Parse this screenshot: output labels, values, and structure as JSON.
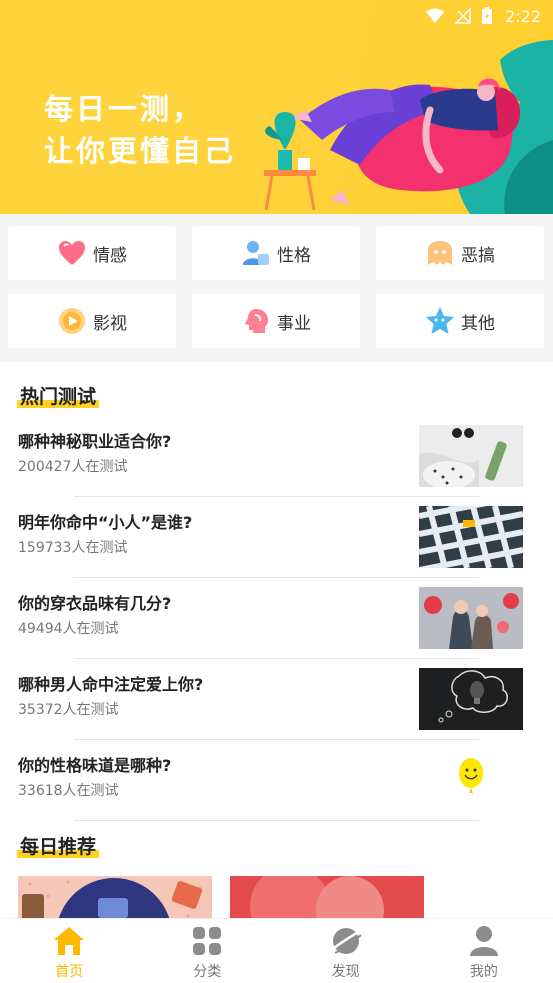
{
  "status_bar": {
    "time": "2:22"
  },
  "banner": {
    "line1": "每日一测，",
    "line2": "让你更懂自己"
  },
  "categories": [
    {
      "label": "情感",
      "icon": "heart-icon",
      "color": "#ff6b8a"
    },
    {
      "label": "性格",
      "icon": "person-icon",
      "color": "#5aa8f0"
    },
    {
      "label": "恶搞",
      "icon": "ghost-icon",
      "color": "#ffb65c"
    },
    {
      "label": "影视",
      "icon": "play-icon",
      "color": "#ffb53c"
    },
    {
      "label": "事业",
      "icon": "head-icon",
      "color": "#ff7a8c"
    },
    {
      "label": "其他",
      "icon": "star-icon",
      "color": "#4bb6f0"
    }
  ],
  "hot": {
    "title": "热门测试",
    "items": [
      {
        "question": "哪种神秘职业适合你?",
        "count": "200427人在测试",
        "thumb": "sunglasses-bottle-photo"
      },
      {
        "question": "明年你命中“小人”是谁?",
        "count": "159733人在测试",
        "thumb": "tile-floor-photo"
      },
      {
        "question": "你的穿衣品味有几分?",
        "count": "49494人在测试",
        "thumb": "couple-balloons-photo"
      },
      {
        "question": "哪种男人命中注定爱上你?",
        "count": "35372人在测试",
        "thumb": "chalkboard-bulb-photo"
      },
      {
        "question": "你的性格味道是哪种?",
        "count": "33618人在测试",
        "thumb": "smiley-balloon-photo"
      }
    ]
  },
  "daily": {
    "title": "每日推荐"
  },
  "nav": [
    {
      "label": "首页",
      "icon": "home-icon",
      "active": true
    },
    {
      "label": "分类",
      "icon": "grid-icon",
      "active": false
    },
    {
      "label": "发现",
      "icon": "planet-icon",
      "active": false
    },
    {
      "label": "我的",
      "icon": "user-icon",
      "active": false
    }
  ],
  "colors": {
    "accent": "#ffb800",
    "highlight": "#ffd21f",
    "banner_bg": "#ffd43a"
  }
}
